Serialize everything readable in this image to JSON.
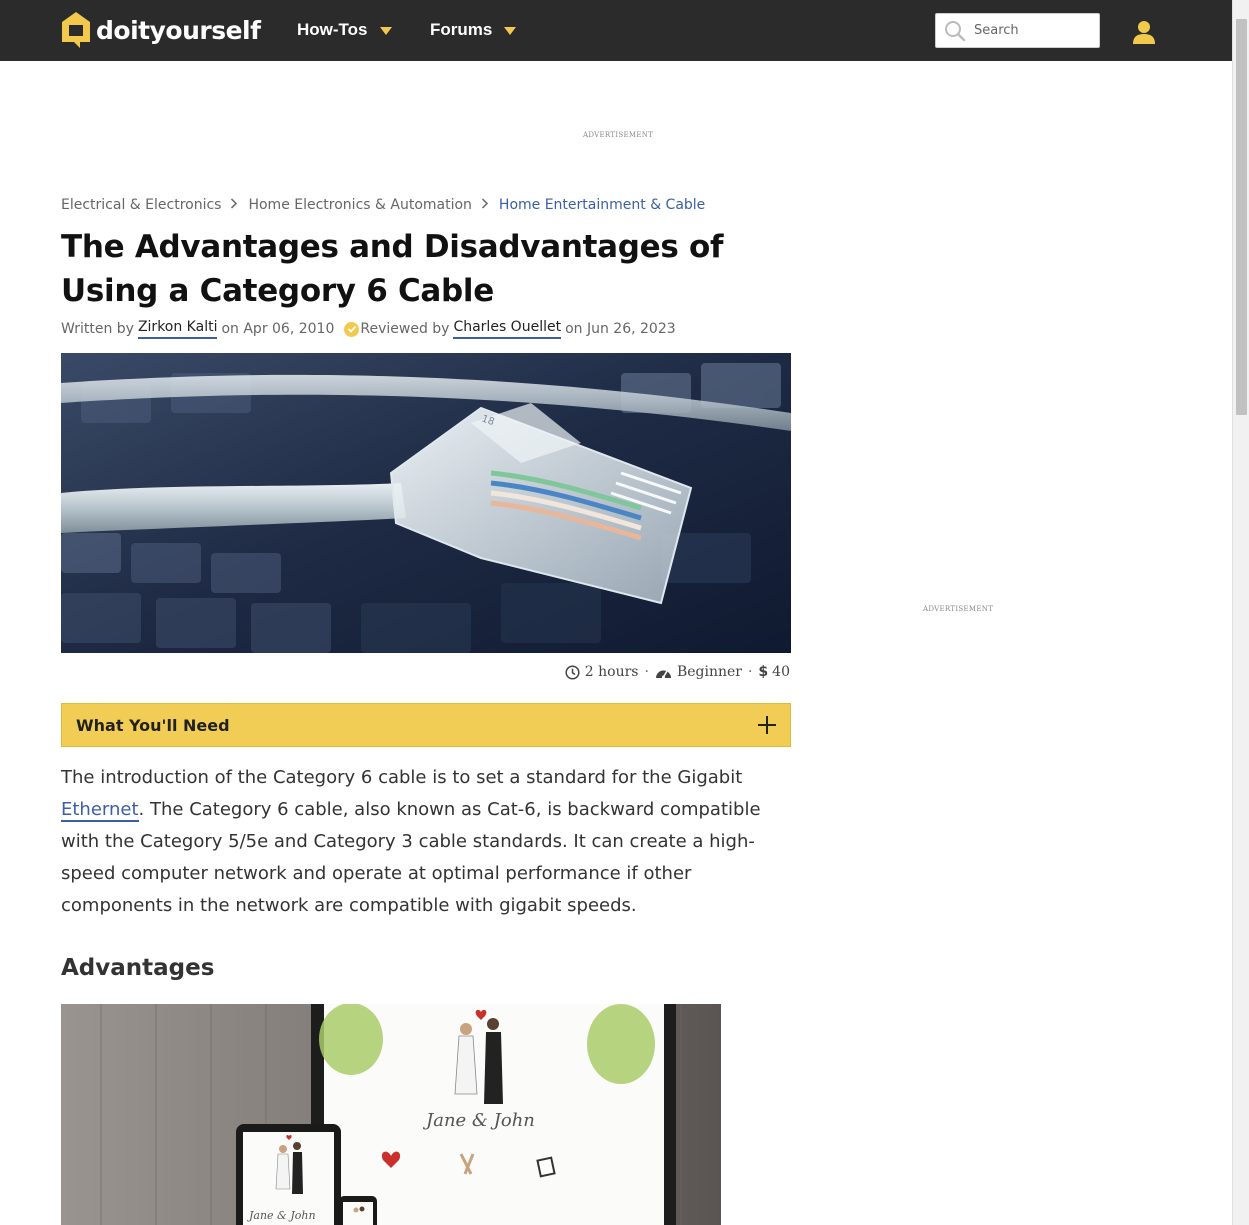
{
  "header": {
    "logo_text": "doityourself",
    "nav": [
      {
        "label": "How-Tos"
      },
      {
        "label": "Forums"
      }
    ],
    "search_placeholder": "Search"
  },
  "ads": {
    "top_label": "ADVERTISEMENT",
    "side_label": "ADVERTISEMENT"
  },
  "breadcrumb": [
    "Electrical & Electronics",
    "Home Electronics & Automation",
    "Home Entertainment & Cable"
  ],
  "article": {
    "title": "The Advantages and Disadvantages of Using a Category 6 Cable",
    "byline": {
      "written_by": "Written by",
      "author": "Zirkon Kalti",
      "written_on": "on Apr 06, 2010",
      "reviewed_by": "Reviewed by",
      "reviewer": "Charles Ouellet",
      "reviewed_on": "on Jun 26, 2023"
    },
    "meta": {
      "time": "2 hours",
      "difficulty": "Beginner",
      "cost": "40"
    },
    "need_label": "What You'll Need",
    "intro_before_link": "The introduction of the Category 6 cable is to set a standard for the Gigabit ",
    "intro_link": "Ethernet",
    "intro_after_link": ". The Category 6 cable, also known as Cat-6, is backward compatible with the Category 5/5e and Category 3 cable standards. It can create a high-speed computer network and operate at optimal performance if other components in the network are compatible with gigabit speeds.",
    "section_heading": "Advantages",
    "image_caption_text": "Jane & John"
  },
  "colors": {
    "header_bg": "#2b2b2b",
    "accent_yellow": "#f2cd55",
    "link_blue": "#3a5fa5"
  }
}
